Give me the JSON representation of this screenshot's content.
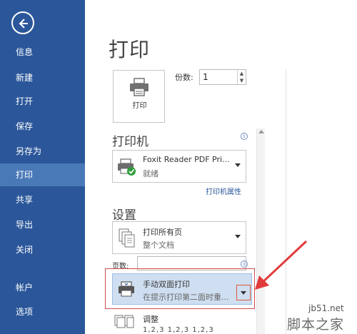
{
  "sidebar": {
    "items": [
      {
        "label": "信息",
        "active": false
      },
      {
        "label": "新建",
        "active": false
      },
      {
        "label": "打开",
        "active": false
      },
      {
        "label": "保存",
        "active": false
      },
      {
        "label": "另存为",
        "active": false
      },
      {
        "label": "打印",
        "active": true
      },
      {
        "label": "共享",
        "active": false
      },
      {
        "label": "导出",
        "active": false
      },
      {
        "label": "关闭",
        "active": false
      },
      {
        "label": "帐户",
        "active": false
      },
      {
        "label": "选项",
        "active": false
      }
    ]
  },
  "main": {
    "title": "打印",
    "print_button_label": "打印",
    "copies_label": "份数:",
    "copies_value": "1",
    "printer_heading": "打印机",
    "printer_name": "Foxit Reader PDF Pri...",
    "printer_status": "就绪",
    "printer_properties_link": "打印机属性",
    "settings_heading": "设置",
    "print_scope_main": "打印所有页",
    "print_scope_sub": "整个文档",
    "pages_label": "页数:",
    "pages_value": "",
    "duplex_main": "手动双面打印",
    "duplex_sub": "在提示打印第二面时重...",
    "collate_main": "调整",
    "collate_sub": "1,2,3    1,2,3    1,2,3"
  },
  "watermark": {
    "line1": "jb51.net",
    "line2": "脚本之家"
  },
  "colors": {
    "sidebar_bg": "#2b579a",
    "sidebar_active": "#4a79b8",
    "highlight_red": "#d04d4d",
    "link_blue": "#2b579a"
  }
}
